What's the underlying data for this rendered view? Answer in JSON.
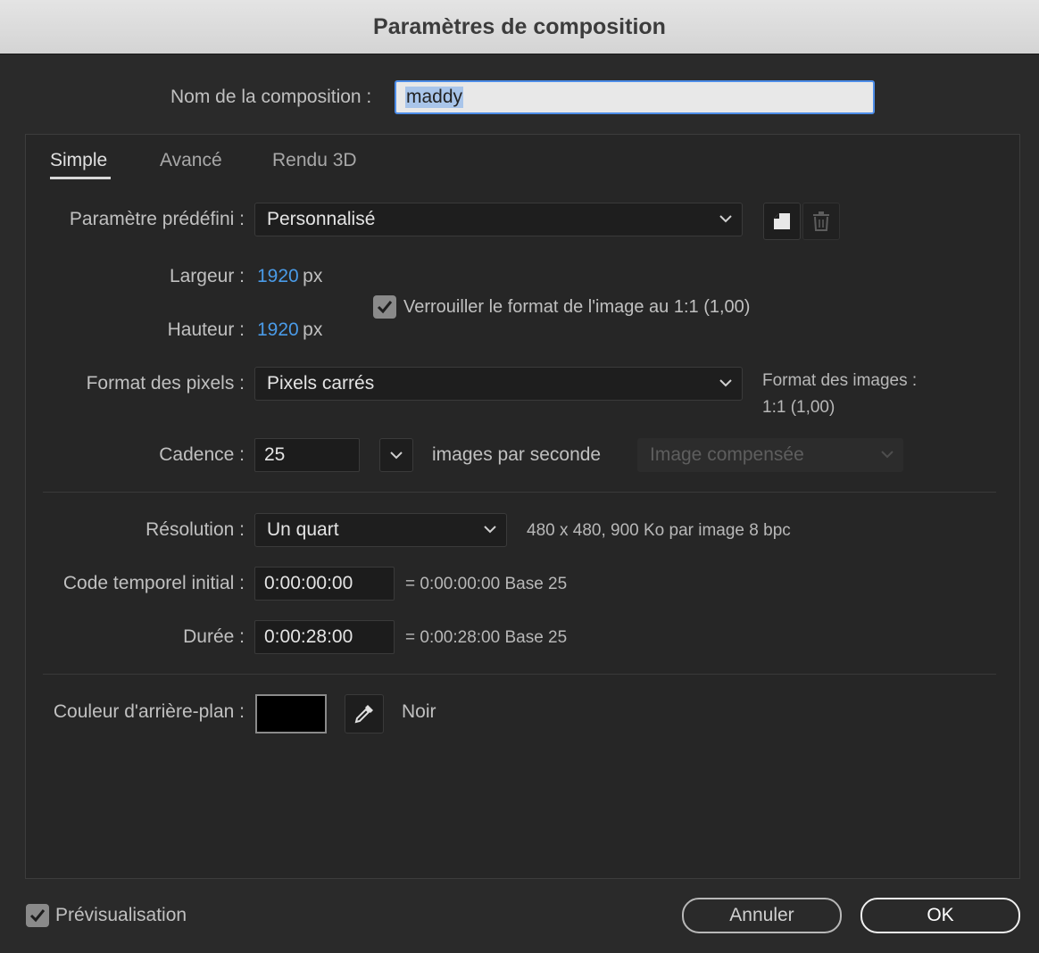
{
  "window": {
    "title": "Paramètres de composition"
  },
  "comp_name": {
    "label": "Nom de la composition :",
    "value": "maddy"
  },
  "tabs": [
    {
      "label": "Simple",
      "active": true
    },
    {
      "label": "Avancé",
      "active": false
    },
    {
      "label": "Rendu 3D",
      "active": false
    }
  ],
  "preset": {
    "label": "Paramètre prédéfini :",
    "value": "Personnalisé",
    "save_icon": "save-preset-icon",
    "delete_icon": "trash-icon"
  },
  "width": {
    "label": "Largeur :",
    "value": "1920",
    "unit": "px"
  },
  "height": {
    "label": "Hauteur :",
    "value": "1920",
    "unit": "px"
  },
  "lock_aspect": {
    "label": "Verrouiller le format de l'image au 1:1 (1,00)",
    "checked": true
  },
  "pixel_aspect": {
    "label": "Format des pixels :",
    "value": "Pixels carrés",
    "frame_aspect_label": "Format des images :",
    "frame_aspect_value": "1:1 (1,00)"
  },
  "frame_rate": {
    "label": "Cadence :",
    "value": "25",
    "unit_label": "images par seconde",
    "drop_frame": "Image compensée"
  },
  "resolution": {
    "label": "Résolution :",
    "value": "Un quart",
    "info": "480 x 480, 900 Ko par image 8 bpc"
  },
  "start_timecode": {
    "label": "Code temporel initial :",
    "value": "0:00:00:00",
    "info": "= 0:00:00:00  Base 25"
  },
  "duration": {
    "label": "Durée :",
    "value": "0:00:28:00",
    "info": "= 0:00:28:00  Base 25"
  },
  "background": {
    "label": "Couleur d'arrière-plan :",
    "color": "#000000",
    "name": "Noir"
  },
  "footer": {
    "preview_label": "Prévisualisation",
    "preview_checked": true,
    "cancel_label": "Annuler",
    "ok_label": "OK"
  },
  "colors": {
    "accent_blue": "#4a9be8",
    "focus_border": "#4d8de8",
    "panel_bg": "#262626"
  }
}
